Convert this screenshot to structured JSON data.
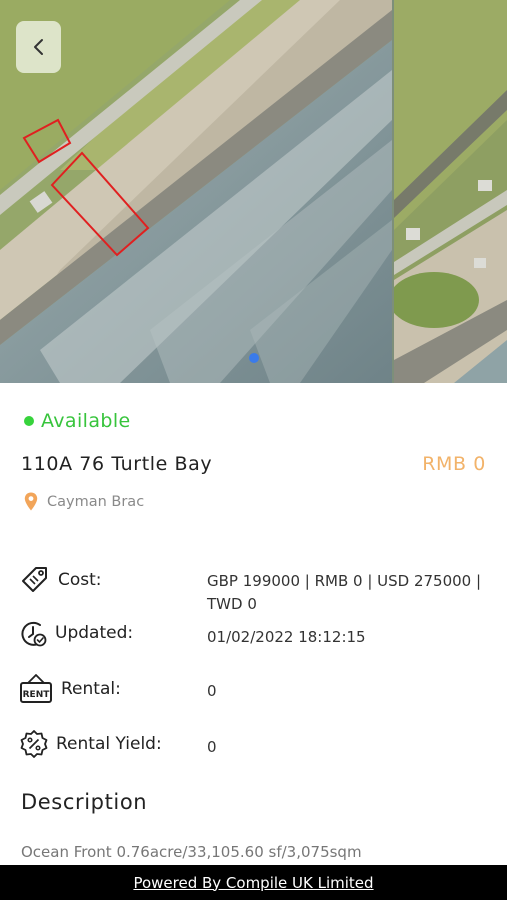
{
  "gallery": {
    "back_icon": "chevron-left-icon",
    "image_count": 2,
    "active_index": 0,
    "colors": {
      "indicator": "#3a7bea",
      "plot_outline": "#e02020"
    }
  },
  "listing": {
    "status": "Available",
    "status_color": "#37c43c",
    "title": "110A 76 Turtle Bay",
    "price": "RMB 0",
    "price_color": "#f2b36a",
    "location": "Cayman Brac",
    "location_icon": "map-pin-icon"
  },
  "details": {
    "cost_label": "Cost:",
    "cost_value_line1": "GBP 199000 | RMB 0 | USD 275000 |",
    "cost_value_line2": "TWD 0",
    "updated_label": "Updated:",
    "updated_value": "01/02/2022 18:12:15",
    "rental_label": "Rental:",
    "rental_value": "0",
    "yield_label": "Rental Yield:",
    "yield_value": "0",
    "icons": [
      "price-tag-icon",
      "clock-check-icon",
      "rent-sign-icon",
      "percent-badge-icon"
    ]
  },
  "description": {
    "heading": "Description",
    "text": "Ocean Front 0.76acre/33,105.60 sf/3,075sqm"
  },
  "footer": {
    "link": "Powered By Compile UK Limited"
  }
}
